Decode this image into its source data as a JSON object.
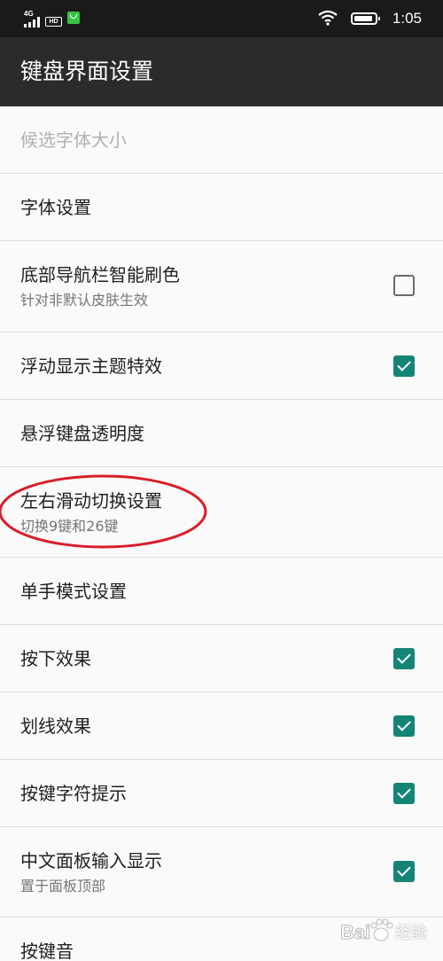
{
  "status_bar": {
    "network": "4G",
    "hd": "HD",
    "time": "1:05"
  },
  "header": {
    "title": "键盘界面设置"
  },
  "settings": {
    "candidate_font_size": {
      "title": "候选字体大小",
      "enabled": false
    },
    "font_settings": {
      "title": "字体设置"
    },
    "nav_bar_tint": {
      "title": "底部导航栏智能刷色",
      "summary": "针对非默认皮肤生效",
      "checked": false
    },
    "float_theme_effect": {
      "title": "浮动显示主题特效",
      "checked": true
    },
    "float_keyboard_opacity": {
      "title": "悬浮键盘透明度"
    },
    "swipe_switch": {
      "title": "左右滑动切换设置",
      "summary": "切换9键和26键",
      "highlighted": true
    },
    "one_hand_mode": {
      "title": "单手模式设置"
    },
    "press_effect": {
      "title": "按下效果",
      "checked": true
    },
    "stroke_effect": {
      "title": "划线效果",
      "checked": true
    },
    "key_char_hint": {
      "title": "按键字符提示",
      "checked": true
    },
    "chinese_panel_input": {
      "title": "中文面板输入显示",
      "summary": "置于面板顶部",
      "checked": true
    },
    "key_sound": {
      "title": "按键音"
    }
  },
  "colors": {
    "checkbox_checked": "#148575",
    "annotation_circle": "#d81e2a",
    "app_bar": "#2b2b2b"
  },
  "watermark": {
    "text": "Bai经验"
  }
}
